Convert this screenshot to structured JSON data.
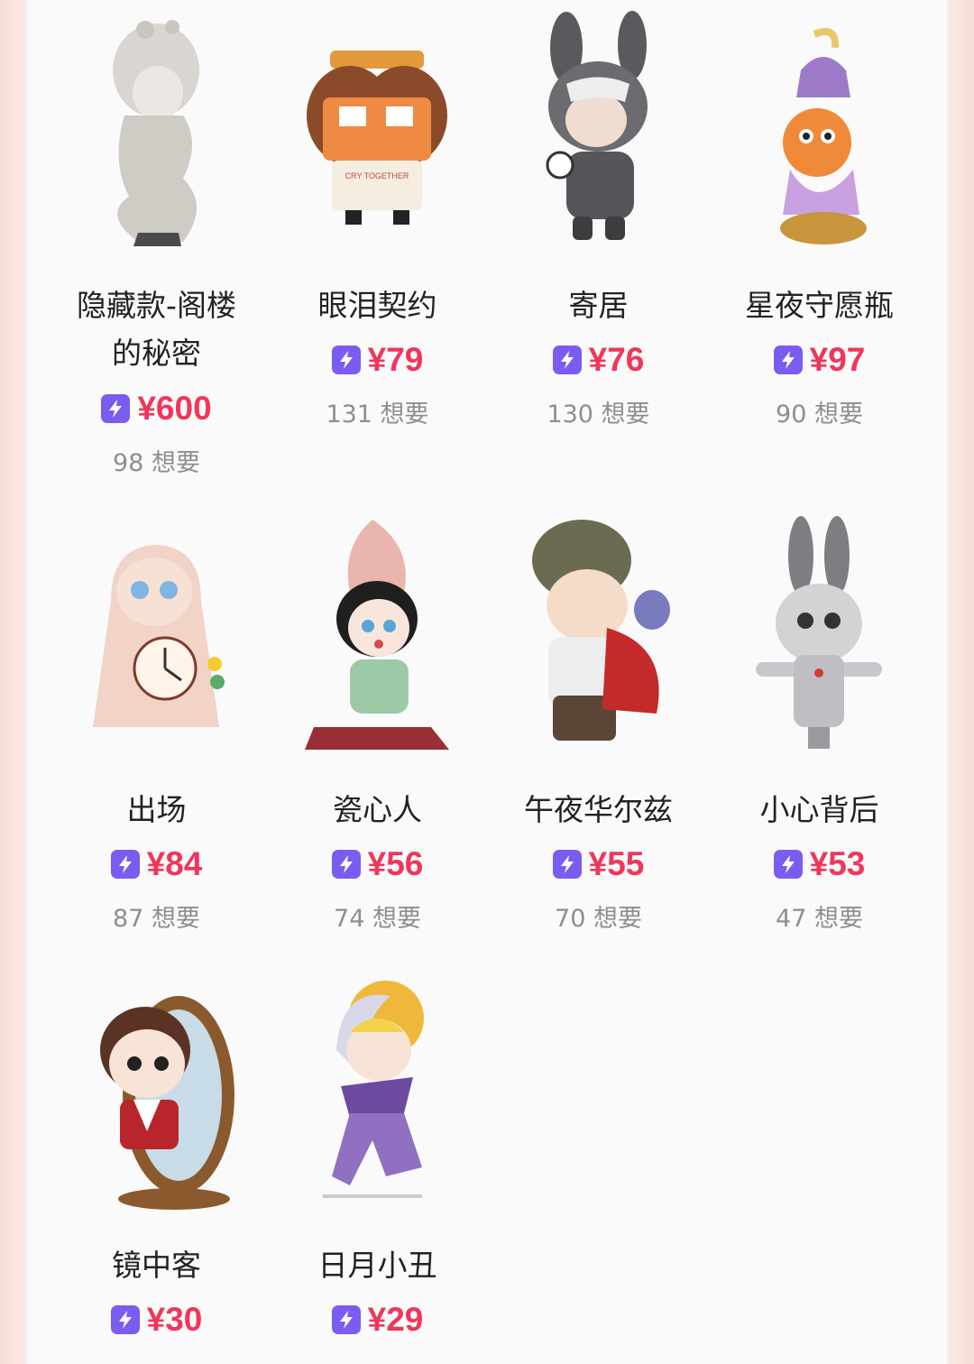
{
  "colors": {
    "accent": "#7b5cf0",
    "price": "#f0365a",
    "muted": "#8e8e8e"
  },
  "products": [
    {
      "name_line1": "隐藏款-阁楼",
      "name_line2": "的秘密",
      "price": "¥600",
      "wants": "98 想要",
      "icon": "bolt-icon"
    },
    {
      "name_line1": "眼泪契约",
      "price": "¥79",
      "wants": "131 想要",
      "icon": "bolt-icon"
    },
    {
      "name_line1": "寄居",
      "price": "¥76",
      "wants": "130 想要",
      "icon": "bolt-icon"
    },
    {
      "name_line1": "星夜守愿瓶",
      "price": "¥97",
      "wants": "90 想要",
      "icon": "bolt-icon"
    },
    {
      "name_line1": "出场",
      "price": "¥84",
      "wants": "87 想要",
      "icon": "bolt-icon"
    },
    {
      "name_line1": "瓷心人",
      "price": "¥56",
      "wants": "74 想要",
      "icon": "bolt-icon"
    },
    {
      "name_line1": "午夜华尔兹",
      "price": "¥55",
      "wants": "70 想要",
      "icon": "bolt-icon"
    },
    {
      "name_line1": "小心背后",
      "price": "¥53",
      "wants": "47 想要",
      "icon": "bolt-icon"
    },
    {
      "name_line1": "镜中客",
      "price": "¥30",
      "icon": "bolt-icon"
    },
    {
      "name_line1": "日月小丑",
      "price": "¥29",
      "icon": "bolt-icon"
    }
  ]
}
